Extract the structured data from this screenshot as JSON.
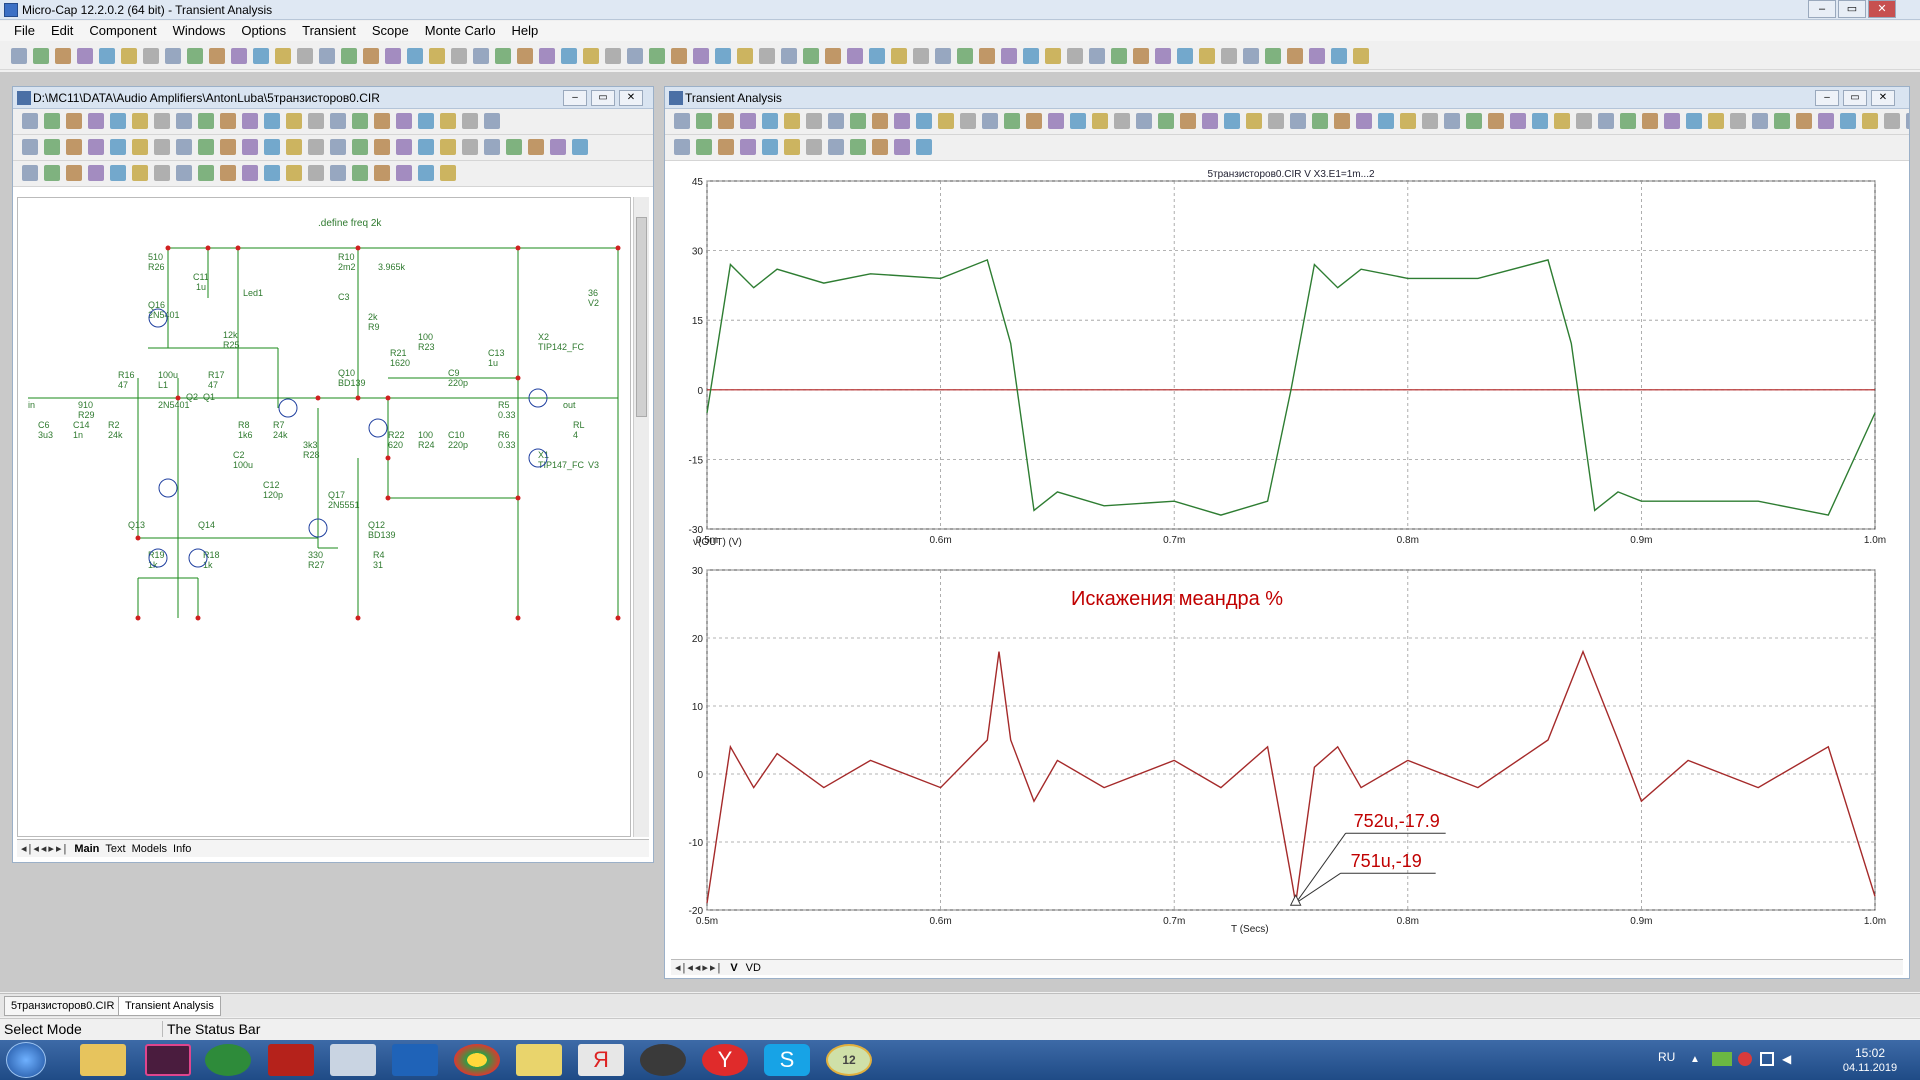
{
  "app": {
    "title": "Micro-Cap 12.2.0.2 (64 bit) - Transient Analysis",
    "window_buttons": [
      "–",
      "▭",
      "✕"
    ]
  },
  "menu": [
    "File",
    "Edit",
    "Component",
    "Windows",
    "Options",
    "Transient",
    "Scope",
    "Monte Carlo",
    "Help"
  ],
  "schematic_window": {
    "title": "D:\\MC11\\DATA\\Audio Amplifiers\\AntonLuba\\5транзисторов0.CIR",
    "define": ".define freq 2k",
    "tabs": [
      "Main",
      "Text",
      "Models",
      "Info"
    ],
    "labels": [
      "510",
      "R26",
      "C11",
      "1u",
      "Led1",
      "Q16",
      "2N5401",
      "12k",
      "R25",
      "R10",
      "2m2",
      "3.965k",
      "C3",
      "2k",
      "R9",
      "100",
      "R23",
      "X2",
      "TIP142_FC",
      "36",
      "V2",
      "R21",
      "1620",
      "Q10",
      "BD139",
      "C9",
      "220p",
      "C13",
      "1u",
      "R5",
      "0.33",
      "910",
      "R29",
      "R16",
      "47",
      "100u",
      "L1",
      "R17",
      "47",
      "Q1",
      "Q2",
      "C6",
      "3u3",
      "C14",
      "1n",
      "R2",
      "24k",
      "2N5401",
      "R8",
      "1k6",
      "R7",
      "24k",
      "3k3",
      "R28",
      "R22",
      "620",
      "100",
      "R24",
      "C10",
      "220p",
      "R6",
      "0.33",
      "RL",
      "4",
      "out",
      "in",
      "X1",
      "TIP147_FC",
      "V3",
      "C2",
      "100u",
      "C12",
      "120p",
      "Q17",
      "2N5551",
      "Q13",
      "Q14",
      "Q12",
      "BD139",
      "R19",
      "1k",
      "R18",
      "1k",
      "330",
      "R27",
      "R4",
      "31"
    ]
  },
  "analysis_window": {
    "title": "Transient Analysis",
    "top_plot": {
      "header": "5транзисторов0.CIR V X3.E1=1m...2",
      "y_ticks": [
        "45",
        "30",
        "15",
        "0",
        "-15",
        "-30"
      ],
      "x_ticks": [
        "0.5m",
        "0.6m",
        "0.7m",
        "0.8m",
        "0.9m",
        "1.0m"
      ],
      "y_label": "v(OUT) (V)"
    },
    "bottom_plot": {
      "title": "Искажения меандра %",
      "y_ticks": [
        "30",
        "20",
        "10",
        "0",
        "-10",
        "-20"
      ],
      "x_ticks": [
        "0.5m",
        "0.6m",
        "0.7m",
        "0.8m",
        "0.9m",
        "1.0m"
      ],
      "x_label": "T (Secs)",
      "annotations": [
        "752u,-17.9",
        "751u,-19"
      ]
    },
    "tabs": [
      "V",
      "VD"
    ]
  },
  "doc_tabs": [
    "5транзисторов0.CIR",
    "Transient Analysis"
  ],
  "status": {
    "mode": "Select Mode",
    "message": "The Status Bar"
  },
  "taskbar": {
    "lang": "RU",
    "time": "15:02",
    "date": "04.11.2019"
  },
  "colors": {
    "out_wave": "#2e7d32",
    "distortion_wave": "#a52a2a",
    "schematic_wire": "#1a8a1a",
    "schematic_label": "#2f7a2f",
    "grid": "#9a9a9a",
    "zero_line": "#b02020",
    "annotation": "#c00000"
  },
  "chart_data": [
    {
      "type": "line",
      "title": "5транзисторов0.CIR V X3.E1=1m...2",
      "ylabel": "v(OUT) (V)",
      "xlim": [
        0.0005,
        0.001
      ],
      "ylim": [
        -30,
        45
      ],
      "series": [
        {
          "x": [
            0.0005,
            0.00051,
            0.00052,
            0.00053,
            0.00055,
            0.00057,
            0.0006,
            0.00062,
            0.00063,
            0.00064,
            0.00065,
            0.00067,
            0.0007,
            0.00072,
            0.00074,
            0.00075,
            0.00076,
            0.00077,
            0.00078,
            0.0008,
            0.00083,
            0.00086,
            0.00087,
            0.00088,
            0.00089,
            0.0009,
            0.00092,
            0.00095,
            0.00098,
            0.001
          ],
          "y": [
            -5,
            27,
            22,
            26,
            23,
            25,
            24,
            28,
            10,
            -26,
            -22,
            -25,
            -24,
            -27,
            -24,
            0,
            27,
            22,
            26,
            24,
            24,
            28,
            10,
            -26,
            -22,
            -24,
            -24,
            -24,
            -27,
            -5
          ]
        }
      ]
    },
    {
      "type": "line",
      "title": "Искажения меандра %",
      "xlabel": "T (Secs)",
      "xlim": [
        0.0005,
        0.001
      ],
      "ylim": [
        -20,
        30
      ],
      "series": [
        {
          "x": [
            0.0005,
            0.00051,
            0.00052,
            0.00053,
            0.00055,
            0.00057,
            0.0006,
            0.00062,
            0.000625,
            0.00063,
            0.00064,
            0.00065,
            0.00067,
            0.0007,
            0.00072,
            0.00074,
            0.00075,
            0.000752,
            0.00076,
            0.00077,
            0.00078,
            0.0008,
            0.00083,
            0.00086,
            0.000875,
            0.00089,
            0.0009,
            0.00092,
            0.00095,
            0.00098,
            0.001
          ],
          "y": [
            -19,
            4,
            -2,
            3,
            -2,
            2,
            -2,
            5,
            18,
            5,
            -4,
            2,
            -2,
            2,
            -2,
            4,
            -15,
            -19,
            1,
            4,
            -2,
            2,
            -2,
            5,
            18,
            5,
            -4,
            2,
            -2,
            4,
            -18
          ]
        }
      ]
    }
  ]
}
